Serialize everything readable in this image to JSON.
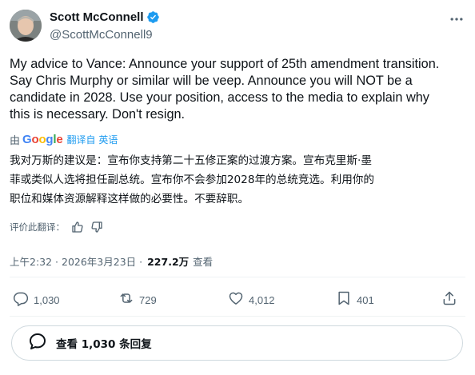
{
  "author": {
    "name": "Scott McConnell",
    "handle": "@ScottMcConnell9",
    "verified": true
  },
  "tweet": {
    "lines": [
      "My advice to Vance: Announce your support of 25th amendment transition.",
      "Say Chris Murphy or similar will be veep. Announce  you will NOT be a",
      "candidate in 2028. Use your position, access to the media to explain why",
      "this is necessary. Don't resign."
    ]
  },
  "translation": {
    "by": "由",
    "provider": "Google",
    "label": "翻译自 英语",
    "lines": [
      "我对万斯的建议是：宣布你支持第二十五修正案的过渡方案。宣布克里斯·墨",
      "菲或类似人选将担任副总统。宣布你不会参加2028年的总统竞选。利用你的",
      "职位和媒体资源解释这样做的必要性。不要辞职。"
    ],
    "rate_prompt": "评价此翻译："
  },
  "meta": {
    "time": "上午2:32 · 2026年3月23日 · ",
    "views": "227.2万",
    "views_label": "查看"
  },
  "actions": {
    "replies": "1,030",
    "reposts": "729",
    "likes": "4,012",
    "bookmarks": "401"
  },
  "reply_bar": {
    "label": "查看 1,030 条回复"
  },
  "colors": {
    "verified": "#1d9bf0",
    "secondary_text": "#536471",
    "link": "#1d9bf0"
  }
}
